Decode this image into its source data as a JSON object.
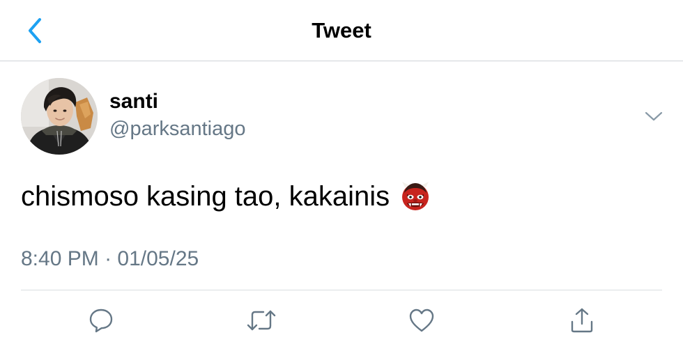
{
  "header": {
    "title": "Tweet",
    "back_icon": "chevron-left-icon",
    "accent_color": "#1da1f2"
  },
  "tweet": {
    "display_name": "santi",
    "handle": "@parksantiago",
    "text": "chismoso kasing tao, kakainis",
    "emoji": "japanese-ogre-emoji",
    "time": "8:40 PM",
    "separator": "·",
    "date": "01/05/25",
    "menu_icon": "chevron-down-icon"
  },
  "actions": [
    {
      "icon": "reply-icon"
    },
    {
      "icon": "retweet-icon"
    },
    {
      "icon": "like-icon"
    },
    {
      "icon": "share-icon"
    }
  ],
  "colors": {
    "secondary_text": "#657786",
    "icon_gray": "#657786",
    "border": "#cfd3d7"
  }
}
